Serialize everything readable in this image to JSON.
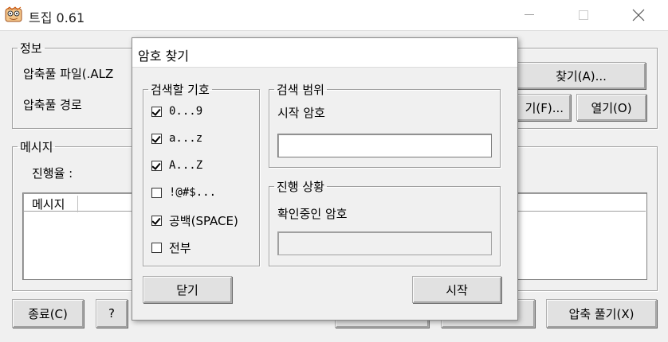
{
  "window": {
    "title": "트집 0.61",
    "minimize_icon": "minimize-icon",
    "maximize_icon": "maximize-icon",
    "close_icon": "close-icon"
  },
  "info_group": {
    "legend": "정보",
    "archive_file_label": "압축풀 파일(.ALZ",
    "archive_path_label": "압축풀 경로",
    "find_button": "찾기(A)...",
    "find_folder_button": "기(F)...",
    "open_button": "열기(O)"
  },
  "message_group": {
    "legend": "메시지",
    "progress_label": "진행율 :",
    "list_header": "메시지"
  },
  "bottom_buttons": {
    "exit": "종료(C)",
    "help": "?",
    "extract": "압축 풀기(X)"
  },
  "dialog": {
    "title": "암호 찾기",
    "symbols_group": {
      "legend": "검색할 기호",
      "options": [
        {
          "label": "0...9",
          "checked": true,
          "mono": true
        },
        {
          "label": "a...z",
          "checked": true,
          "mono": true
        },
        {
          "label": "A...Z",
          "checked": true,
          "mono": true
        },
        {
          "label": "!@#$...",
          "checked": false,
          "mono": true
        },
        {
          "label": "공백(SPACE)",
          "checked": true,
          "mono": false
        },
        {
          "label": "전부",
          "checked": false,
          "mono": false
        }
      ]
    },
    "range_group": {
      "legend": "검색 범위",
      "start_password_label": "시작 암호",
      "start_password_value": ""
    },
    "progress_group": {
      "legend": "진행 상황",
      "checking_label": "확인중인 암호",
      "checking_value": ""
    },
    "close_button": "닫기",
    "start_button": "시작"
  }
}
